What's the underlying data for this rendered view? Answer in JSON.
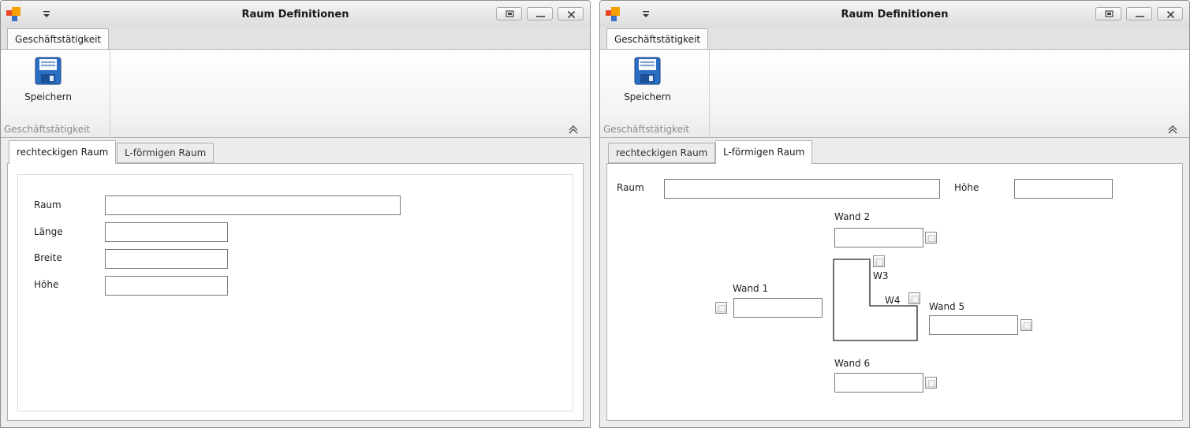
{
  "window_title": "Raum Definitionen",
  "ribbon": {
    "tab_label": "Geschäftstätigkeit",
    "save_label": "Speichern",
    "group_label": "Geschäftstätigkeit"
  },
  "tabs": [
    "rechteckigen Raum",
    "L-förmigen Raum"
  ],
  "rect_form": {
    "raum_label": "Raum",
    "laenge_label": "Länge",
    "breite_label": "Breite",
    "hoehe_label": "Höhe"
  },
  "l_form": {
    "raum_label": "Raum",
    "hoehe_label": "Höhe",
    "wand1_label": "Wand 1",
    "wand2_label": "Wand 2",
    "w3_label": "W3",
    "w4_label": "W4",
    "wand5_label": "Wand 5",
    "wand6_label": "Wand 6"
  },
  "colors": {
    "save_icon": "#2a6fc4",
    "title_bar": "#e4e4e4",
    "app_icon_orange": "#f5a000",
    "app_icon_red": "#e8472a",
    "app_icon_blue": "#3b6fc9"
  }
}
